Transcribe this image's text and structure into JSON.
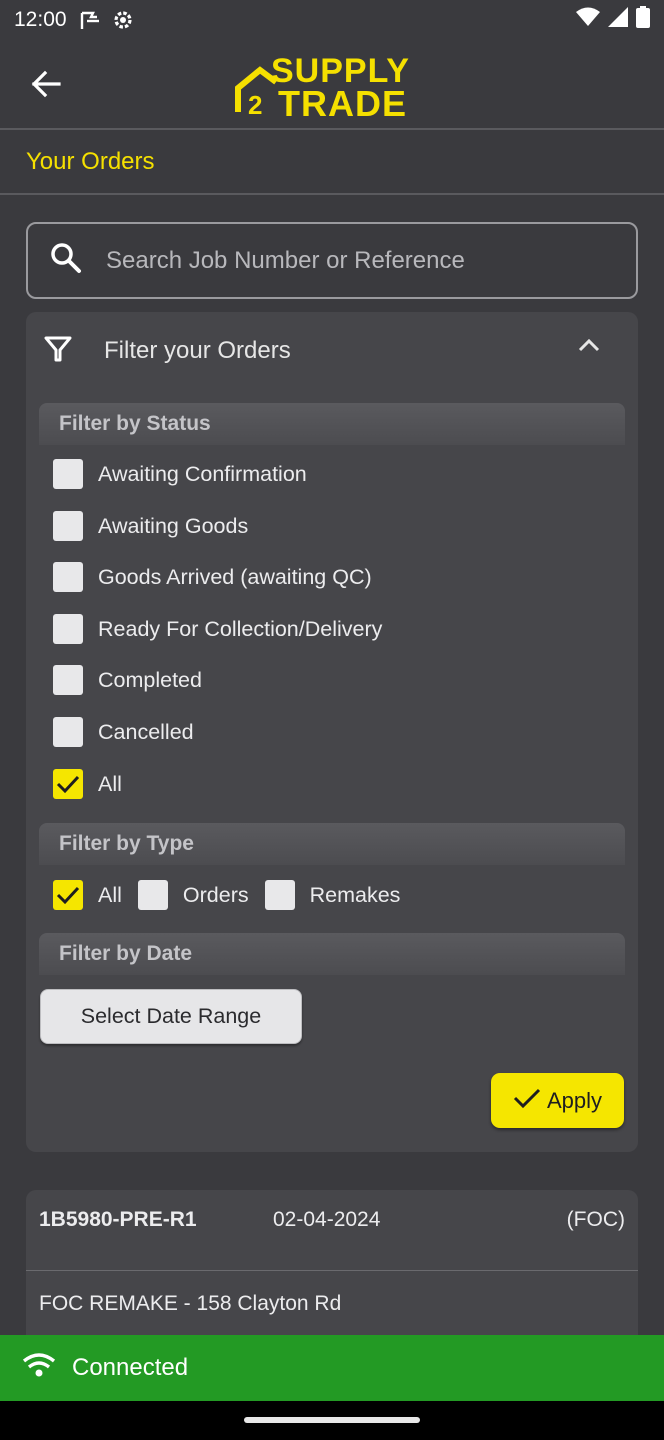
{
  "status_bar": {
    "time": "12:00",
    "left_icons": [
      "flag-icon",
      "gear-icon"
    ],
    "right_icons": [
      "wifi-icon",
      "signal-icon",
      "battery-icon"
    ]
  },
  "app_bar": {
    "back_icon": "arrow-left-icon",
    "logo_line1": "SUPPLY",
    "logo_num": "2",
    "logo_line2": "TRADE"
  },
  "page_title": "Your Orders",
  "search": {
    "placeholder": "Search Job Number or Reference",
    "value": ""
  },
  "filter": {
    "title": "Filter your Orders",
    "expanded": true,
    "status_header": "Filter by Status",
    "status_options": [
      {
        "label": "Awaiting Confirmation",
        "checked": false
      },
      {
        "label": "Awaiting Goods",
        "checked": false
      },
      {
        "label": "Goods Arrived (awaiting QC)",
        "checked": false
      },
      {
        "label": "Ready For Collection/Delivery",
        "checked": false
      },
      {
        "label": "Completed",
        "checked": false
      },
      {
        "label": "Cancelled",
        "checked": false
      },
      {
        "label": "All",
        "checked": true
      }
    ],
    "type_header": "Filter by Type",
    "type_options": [
      {
        "label": "All",
        "checked": true
      },
      {
        "label": "Orders",
        "checked": false
      },
      {
        "label": "Remakes",
        "checked": false
      }
    ],
    "date_header": "Filter by Date",
    "date_button": "Select Date Range",
    "apply_button": "Apply"
  },
  "orders": [
    {
      "job_number": "1B5980-PRE-R1",
      "date": "02-04-2024",
      "tag": "(FOC)",
      "description": "FOC REMAKE - 158 Clayton Rd"
    }
  ],
  "connection": {
    "status": "Connected",
    "color": "#239a24"
  },
  "colors": {
    "accent": "#f5e600",
    "background": "#3a3a3e",
    "card": "#46464a"
  }
}
